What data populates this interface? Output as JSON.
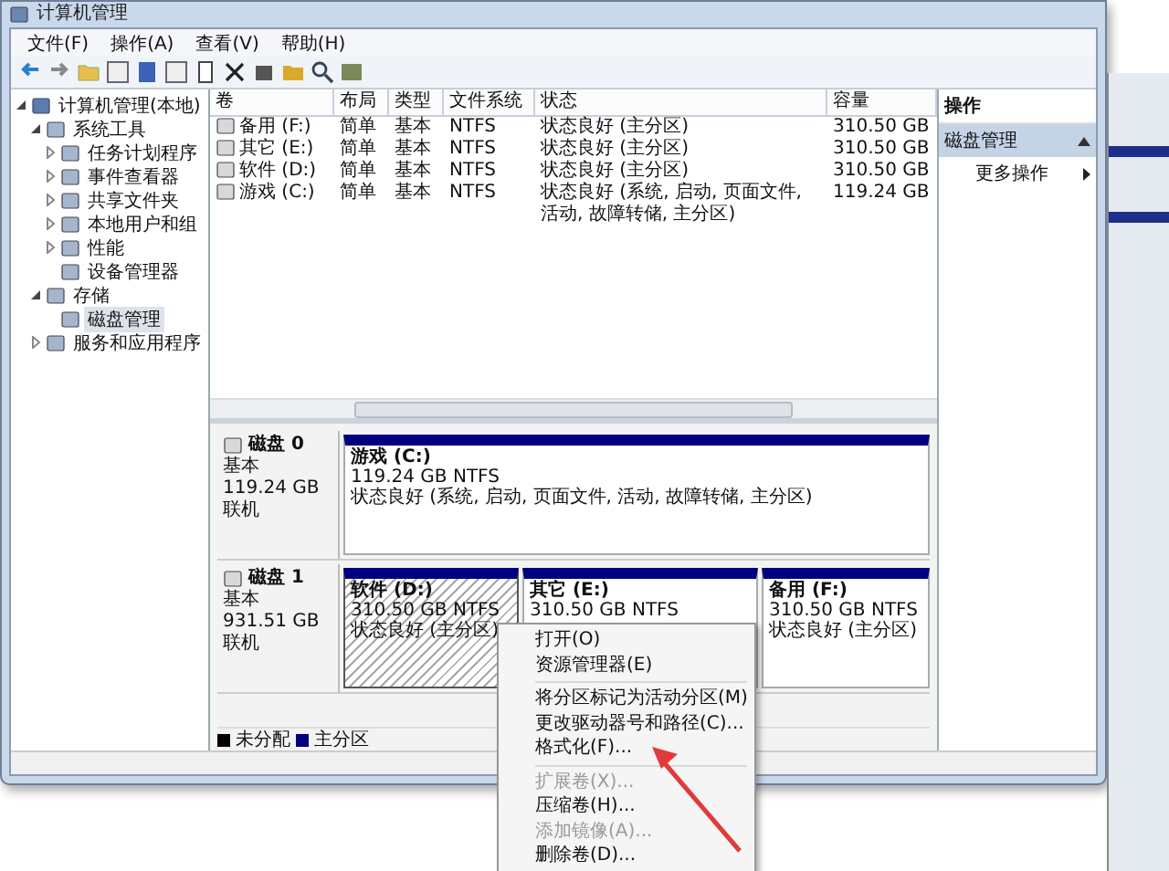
{
  "window": {
    "title": "计算机管理"
  },
  "menu": [
    "文件(F)",
    "操作(A)",
    "查看(V)",
    "帮助(H)"
  ],
  "tree": [
    {
      "label": "计算机管理(本地)",
      "expanded": true,
      "selected": false,
      "children": [
        {
          "label": "系统工具",
          "expanded": true,
          "selected": false,
          "children": [
            {
              "label": "任务计划程序",
              "expanded": false,
              "selected": false
            },
            {
              "label": "事件查看器",
              "expanded": false,
              "selected": false
            },
            {
              "label": "共享文件夹",
              "expanded": false,
              "selected": false
            },
            {
              "label": "本地用户和组",
              "expanded": false,
              "selected": false
            },
            {
              "label": "性能",
              "expanded": false,
              "selected": false
            },
            {
              "label": "设备管理器",
              "selected": false
            }
          ]
        },
        {
          "label": "存储",
          "expanded": true,
          "selected": false,
          "children": [
            {
              "label": "磁盘管理",
              "selected": true
            }
          ]
        },
        {
          "label": "服务和应用程序",
          "expanded": false,
          "selected": false
        }
      ]
    }
  ],
  "volumes": {
    "columns": [
      "卷",
      "布局",
      "类型",
      "文件系统",
      "状态",
      "容量"
    ],
    "rows": [
      [
        "备用 (F:)",
        "简单",
        "基本",
        "NTFS",
        "状态良好 (主分区)",
        "310.50 GB"
      ],
      [
        "其它 (E:)",
        "简单",
        "基本",
        "NTFS",
        "状态良好 (主分区)",
        "310.50 GB"
      ],
      [
        "软件 (D:)",
        "简单",
        "基本",
        "NTFS",
        "状态良好 (主分区)",
        "310.50 GB"
      ],
      [
        "游戏 (C:)",
        "简单",
        "基本",
        "NTFS",
        "状态良好 (系统, 启动, 页面文件, 活动, 故障转储, 主分区)",
        "119.24 GB"
      ]
    ]
  },
  "disks": [
    {
      "name": "磁盘 0",
      "type": "基本",
      "size": "119.24 GB",
      "status": "联机",
      "partitions": [
        {
          "name": "游戏  (C:)",
          "size": "119.24 GB NTFS",
          "status": "状态良好 (系统, 启动, 页面文件, 活动, 故障转储, 主分区)",
          "selected": false
        }
      ]
    },
    {
      "name": "磁盘 1",
      "type": "基本",
      "size": "931.51 GB",
      "status": "联机",
      "partitions": [
        {
          "name": "软件  (D:)",
          "size": "310.50 GB NTFS",
          "status": "状态良好 (主分区)",
          "selected": true
        },
        {
          "name": "其它  (E:)",
          "size": "310.50 GB NTFS",
          "selected": false
        },
        {
          "name": "备用  (F:)",
          "size": "310.50 GB NTFS",
          "status": "状态良好 (主分区)",
          "selected": false
        }
      ]
    }
  ],
  "legend": [
    {
      "label": "未分配",
      "color": "#000000"
    },
    {
      "label": "主分区",
      "color": "#000080"
    }
  ],
  "actions": {
    "header": "操作",
    "section": "磁盘管理",
    "items": [
      "更多操作"
    ]
  },
  "context_menu": [
    {
      "kind": "item",
      "label": "打开(O)",
      "disabled": false
    },
    {
      "kind": "item",
      "label": "资源管理器(E)",
      "disabled": false
    },
    {
      "kind": "separator"
    },
    {
      "kind": "item",
      "label": "将分区标记为活动分区(M)",
      "disabled": false
    },
    {
      "kind": "item",
      "label": "更改驱动器号和路径(C)...",
      "disabled": false
    },
    {
      "kind": "item",
      "label": "格式化(F)...",
      "disabled": false
    },
    {
      "kind": "separator"
    },
    {
      "kind": "item",
      "label": "扩展卷(X)...",
      "disabled": true
    },
    {
      "kind": "item",
      "label": "压缩卷(H)...",
      "disabled": false
    },
    {
      "kind": "item",
      "label": "添加镜像(A)...",
      "disabled": true
    },
    {
      "kind": "item",
      "label": "删除卷(D)...",
      "disabled": false
    }
  ]
}
